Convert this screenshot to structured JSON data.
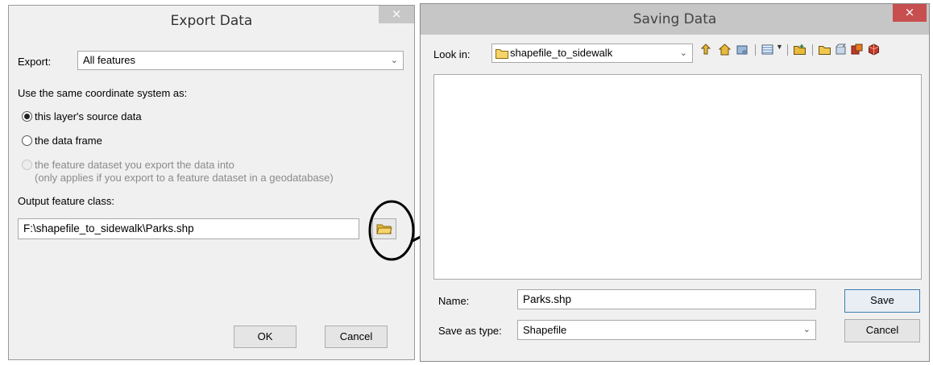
{
  "export_dialog": {
    "title": "Export Data",
    "close_glyph": "×",
    "export_label": "Export:",
    "export_value": "All features",
    "coord_heading": "Use the same coordinate system as:",
    "options": [
      {
        "label": "this layer's source data",
        "selected": true,
        "enabled": true
      },
      {
        "label": "the data frame",
        "selected": false,
        "enabled": true
      },
      {
        "label": "the feature dataset you export the data into",
        "note": "(only applies if you export to a feature dataset in a geodatabase)",
        "selected": false,
        "enabled": false
      }
    ],
    "output_label": "Output feature class:",
    "output_value": "F:\\shapefile_to_sidewalk\\Parks.shp",
    "ok_label": "OK",
    "cancel_label": "Cancel"
  },
  "saving_dialog": {
    "title": "Saving Data",
    "close_glyph": "×",
    "look_in_label": "Look in:",
    "look_in_value": "shapefile_to_sidewalk",
    "toolbar_icons": [
      "up-one-level-icon",
      "home-icon",
      "connect-folder-icon",
      "view-options-icon",
      "new-folder-icon",
      "folder-icon",
      "new-item-icon",
      "catalog-icon",
      "model-icon"
    ],
    "name_label": "Name:",
    "name_value": "Parks.shp",
    "save_type_label": "Save as type:",
    "save_type_value": "Shapefile",
    "save_label": "Save",
    "cancel_label": "Cancel"
  },
  "colors": {
    "accent_folder": "#e8b93a",
    "close_red": "#c74f4f"
  }
}
